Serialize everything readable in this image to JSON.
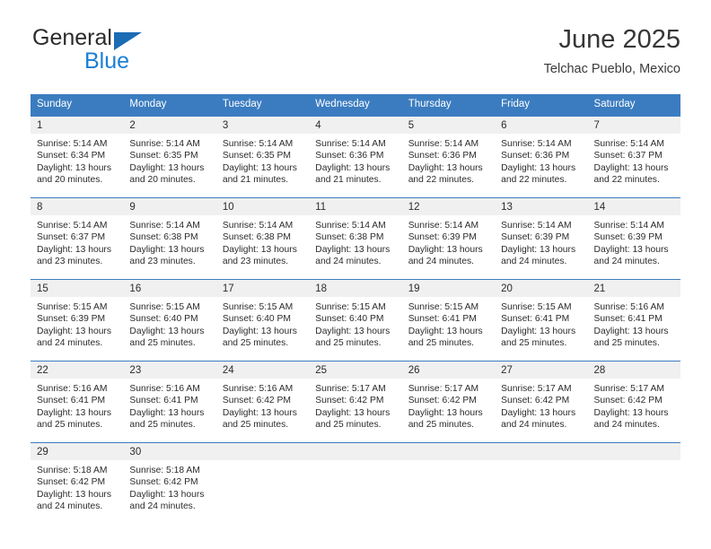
{
  "logo": {
    "word1": "General",
    "word2": "Blue",
    "triangle_color": "#1b6bb5",
    "blue_color": "#1b7fd4"
  },
  "header": {
    "title": "June 2025",
    "subtitle": "Telchac Pueblo, Mexico"
  },
  "theme": {
    "header_blue": "#3b7cc0",
    "daynum_bg": "#f0f0f0",
    "text": "#2b2b2b"
  },
  "calendar": {
    "weekday_headers": [
      "Sunday",
      "Monday",
      "Tuesday",
      "Wednesday",
      "Thursday",
      "Friday",
      "Saturday"
    ],
    "labels": {
      "sunrise": "Sunrise:",
      "sunset": "Sunset:",
      "daylight": "Daylight:"
    },
    "weeks": [
      [
        {
          "day": "1",
          "sunrise": "Sunrise: 5:14 AM",
          "sunset": "Sunset: 6:34 PM",
          "daylight_l1": "Daylight: 13 hours",
          "daylight_l2": "and 20 minutes."
        },
        {
          "day": "2",
          "sunrise": "Sunrise: 5:14 AM",
          "sunset": "Sunset: 6:35 PM",
          "daylight_l1": "Daylight: 13 hours",
          "daylight_l2": "and 20 minutes."
        },
        {
          "day": "3",
          "sunrise": "Sunrise: 5:14 AM",
          "sunset": "Sunset: 6:35 PM",
          "daylight_l1": "Daylight: 13 hours",
          "daylight_l2": "and 21 minutes."
        },
        {
          "day": "4",
          "sunrise": "Sunrise: 5:14 AM",
          "sunset": "Sunset: 6:36 PM",
          "daylight_l1": "Daylight: 13 hours",
          "daylight_l2": "and 21 minutes."
        },
        {
          "day": "5",
          "sunrise": "Sunrise: 5:14 AM",
          "sunset": "Sunset: 6:36 PM",
          "daylight_l1": "Daylight: 13 hours",
          "daylight_l2": "and 22 minutes."
        },
        {
          "day": "6",
          "sunrise": "Sunrise: 5:14 AM",
          "sunset": "Sunset: 6:36 PM",
          "daylight_l1": "Daylight: 13 hours",
          "daylight_l2": "and 22 minutes."
        },
        {
          "day": "7",
          "sunrise": "Sunrise: 5:14 AM",
          "sunset": "Sunset: 6:37 PM",
          "daylight_l1": "Daylight: 13 hours",
          "daylight_l2": "and 22 minutes."
        }
      ],
      [
        {
          "day": "8",
          "sunrise": "Sunrise: 5:14 AM",
          "sunset": "Sunset: 6:37 PM",
          "daylight_l1": "Daylight: 13 hours",
          "daylight_l2": "and 23 minutes."
        },
        {
          "day": "9",
          "sunrise": "Sunrise: 5:14 AM",
          "sunset": "Sunset: 6:38 PM",
          "daylight_l1": "Daylight: 13 hours",
          "daylight_l2": "and 23 minutes."
        },
        {
          "day": "10",
          "sunrise": "Sunrise: 5:14 AM",
          "sunset": "Sunset: 6:38 PM",
          "daylight_l1": "Daylight: 13 hours",
          "daylight_l2": "and 23 minutes."
        },
        {
          "day": "11",
          "sunrise": "Sunrise: 5:14 AM",
          "sunset": "Sunset: 6:38 PM",
          "daylight_l1": "Daylight: 13 hours",
          "daylight_l2": "and 24 minutes."
        },
        {
          "day": "12",
          "sunrise": "Sunrise: 5:14 AM",
          "sunset": "Sunset: 6:39 PM",
          "daylight_l1": "Daylight: 13 hours",
          "daylight_l2": "and 24 minutes."
        },
        {
          "day": "13",
          "sunrise": "Sunrise: 5:14 AM",
          "sunset": "Sunset: 6:39 PM",
          "daylight_l1": "Daylight: 13 hours",
          "daylight_l2": "and 24 minutes."
        },
        {
          "day": "14",
          "sunrise": "Sunrise: 5:14 AM",
          "sunset": "Sunset: 6:39 PM",
          "daylight_l1": "Daylight: 13 hours",
          "daylight_l2": "and 24 minutes."
        }
      ],
      [
        {
          "day": "15",
          "sunrise": "Sunrise: 5:15 AM",
          "sunset": "Sunset: 6:39 PM",
          "daylight_l1": "Daylight: 13 hours",
          "daylight_l2": "and 24 minutes."
        },
        {
          "day": "16",
          "sunrise": "Sunrise: 5:15 AM",
          "sunset": "Sunset: 6:40 PM",
          "daylight_l1": "Daylight: 13 hours",
          "daylight_l2": "and 25 minutes."
        },
        {
          "day": "17",
          "sunrise": "Sunrise: 5:15 AM",
          "sunset": "Sunset: 6:40 PM",
          "daylight_l1": "Daylight: 13 hours",
          "daylight_l2": "and 25 minutes."
        },
        {
          "day": "18",
          "sunrise": "Sunrise: 5:15 AM",
          "sunset": "Sunset: 6:40 PM",
          "daylight_l1": "Daylight: 13 hours",
          "daylight_l2": "and 25 minutes."
        },
        {
          "day": "19",
          "sunrise": "Sunrise: 5:15 AM",
          "sunset": "Sunset: 6:41 PM",
          "daylight_l1": "Daylight: 13 hours",
          "daylight_l2": "and 25 minutes."
        },
        {
          "day": "20",
          "sunrise": "Sunrise: 5:15 AM",
          "sunset": "Sunset: 6:41 PM",
          "daylight_l1": "Daylight: 13 hours",
          "daylight_l2": "and 25 minutes."
        },
        {
          "day": "21",
          "sunrise": "Sunrise: 5:16 AM",
          "sunset": "Sunset: 6:41 PM",
          "daylight_l1": "Daylight: 13 hours",
          "daylight_l2": "and 25 minutes."
        }
      ],
      [
        {
          "day": "22",
          "sunrise": "Sunrise: 5:16 AM",
          "sunset": "Sunset: 6:41 PM",
          "daylight_l1": "Daylight: 13 hours",
          "daylight_l2": "and 25 minutes."
        },
        {
          "day": "23",
          "sunrise": "Sunrise: 5:16 AM",
          "sunset": "Sunset: 6:41 PM",
          "daylight_l1": "Daylight: 13 hours",
          "daylight_l2": "and 25 minutes."
        },
        {
          "day": "24",
          "sunrise": "Sunrise: 5:16 AM",
          "sunset": "Sunset: 6:42 PM",
          "daylight_l1": "Daylight: 13 hours",
          "daylight_l2": "and 25 minutes."
        },
        {
          "day": "25",
          "sunrise": "Sunrise: 5:17 AM",
          "sunset": "Sunset: 6:42 PM",
          "daylight_l1": "Daylight: 13 hours",
          "daylight_l2": "and 25 minutes."
        },
        {
          "day": "26",
          "sunrise": "Sunrise: 5:17 AM",
          "sunset": "Sunset: 6:42 PM",
          "daylight_l1": "Daylight: 13 hours",
          "daylight_l2": "and 25 minutes."
        },
        {
          "day": "27",
          "sunrise": "Sunrise: 5:17 AM",
          "sunset": "Sunset: 6:42 PM",
          "daylight_l1": "Daylight: 13 hours",
          "daylight_l2": "and 24 minutes."
        },
        {
          "day": "28",
          "sunrise": "Sunrise: 5:17 AM",
          "sunset": "Sunset: 6:42 PM",
          "daylight_l1": "Daylight: 13 hours",
          "daylight_l2": "and 24 minutes."
        }
      ],
      [
        {
          "day": "29",
          "sunrise": "Sunrise: 5:18 AM",
          "sunset": "Sunset: 6:42 PM",
          "daylight_l1": "Daylight: 13 hours",
          "daylight_l2": "and 24 minutes."
        },
        {
          "day": "30",
          "sunrise": "Sunrise: 5:18 AM",
          "sunset": "Sunset: 6:42 PM",
          "daylight_l1": "Daylight: 13 hours",
          "daylight_l2": "and 24 minutes."
        },
        {
          "day": "",
          "sunrise": "",
          "sunset": "",
          "daylight_l1": "",
          "daylight_l2": ""
        },
        {
          "day": "",
          "sunrise": "",
          "sunset": "",
          "daylight_l1": "",
          "daylight_l2": ""
        },
        {
          "day": "",
          "sunrise": "",
          "sunset": "",
          "daylight_l1": "",
          "daylight_l2": ""
        },
        {
          "day": "",
          "sunrise": "",
          "sunset": "",
          "daylight_l1": "",
          "daylight_l2": ""
        },
        {
          "day": "",
          "sunrise": "",
          "sunset": "",
          "daylight_l1": "",
          "daylight_l2": ""
        }
      ]
    ]
  }
}
